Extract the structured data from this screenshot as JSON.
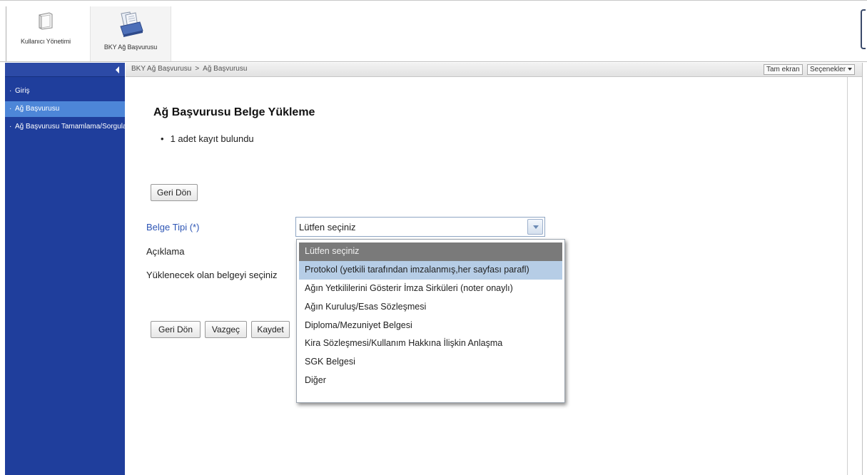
{
  "toolbar": {
    "items": [
      {
        "label": "Kullanıcı Yönetimi",
        "icon": "folder-icon"
      },
      {
        "label": "BKY Ağ Başvurusu",
        "icon": "documents-icon"
      }
    ]
  },
  "sidebar": {
    "items": [
      {
        "label": "Giriş",
        "active": false
      },
      {
        "label": "Ağ Başvurusu",
        "active": true
      },
      {
        "label": "Ağ Başvurusu Tamamlama/Sorgulama",
        "active": false
      }
    ]
  },
  "header": {
    "breadcrumb": [
      "BKY Ağ Başvurusu",
      "Ağ Başvurusu"
    ],
    "breadcrumb_separator": ">",
    "fullscreen_label": "Tam ekran",
    "options_label": "Seçenekler"
  },
  "main": {
    "title": "Ağ Başvurusu Belge Yükleme",
    "result_text": "1 adet kayıt bulundu",
    "back_top_label": "Geri Dön",
    "form": {
      "type_label": "Belge Tipi (*)",
      "description_label": "Açıklama",
      "file_label": "Yüklenecek olan belgeyi seçiniz",
      "type_value": "Lütfen seçiniz"
    },
    "actions": {
      "back_label": "Geri Dön",
      "cancel_label": "Vazgeç",
      "save_label": "Kaydet"
    }
  },
  "dropdown": {
    "options": [
      "Lütfen seçiniz",
      "Protokol (yetkili tarafından imzalanmış,her sayfası parafl)",
      "Ağın Yetkililerini Gösterir İmza Sirküleri (noter onaylı)",
      "Ağın Kuruluş/Esas Sözleşmesi",
      "Diploma/Mezuniyet Belgesi",
      "Kira Sözleşmesi/Kullanım Hakkına İlişkin Anlaşma",
      "SGK Belgesi",
      "Diğer"
    ],
    "highlighted_index": 1
  },
  "colors": {
    "sidebar_bg": "#1f3e9c",
    "sidebar_active": "#4d86d8",
    "required_label": "#2d55b5",
    "dropdown_hover": "#b6cde6"
  }
}
